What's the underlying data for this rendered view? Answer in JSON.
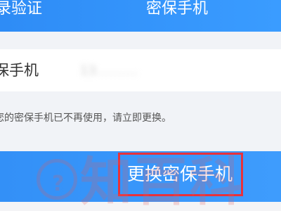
{
  "header": {
    "tabs": [
      {
        "label": "录验证"
      },
      {
        "label": "密保手机"
      }
    ]
  },
  "phone_row": {
    "label": "保手机",
    "value": "13‥‥‥‥‥"
  },
  "hint": "您的密保手机已不再使用，请立即更换。",
  "action": {
    "change_label": "更换密保手机"
  },
  "watermark": {
    "symbol": "?",
    "text": "知百科"
  },
  "colors": {
    "header_blue": "#2e8cf6",
    "action_blue": "#3390f7",
    "highlight_red": "#e8323b",
    "background": "#f1f3f7"
  }
}
